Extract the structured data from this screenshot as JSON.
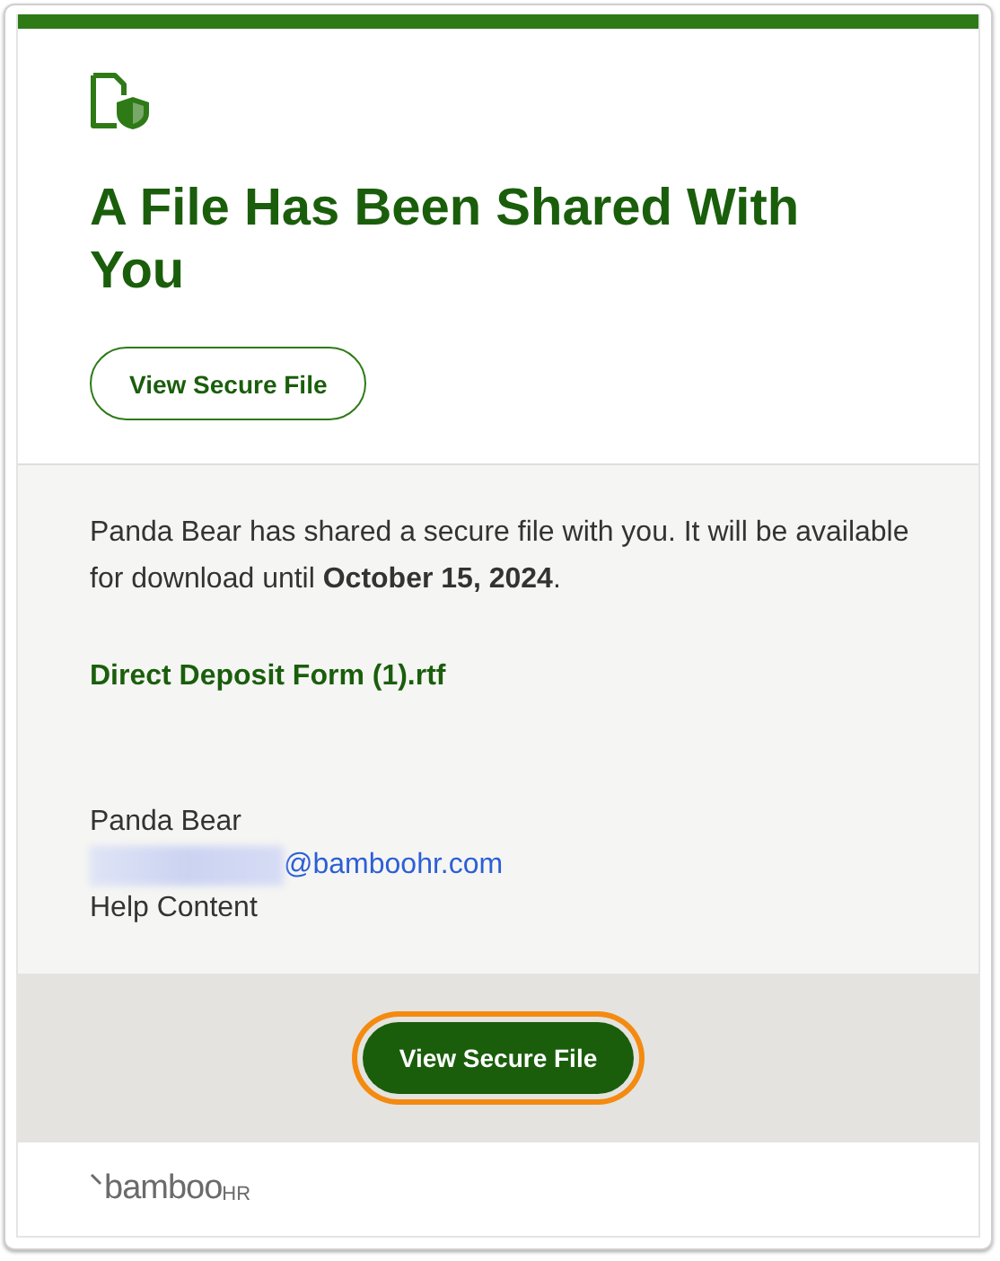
{
  "heading": "A File Has Been Shared With You",
  "top_button": {
    "label": "View Secure File"
  },
  "message": "Panda Bear has shared a secure file with you. It will be available for download until **October 15, 2024**.",
  "file_link": "Direct Deposit Form (1).rtf",
  "signature": {
    "name": "Panda Bear",
    "email_domain": "@bamboohr.com",
    "email_redacted": true,
    "note": "Help Content"
  },
  "bottom_button": {
    "label": "View Secure File",
    "highlighted": true
  },
  "footer": {
    "logo_text": "bamboo",
    "logo_suffix": "HR"
  }
}
